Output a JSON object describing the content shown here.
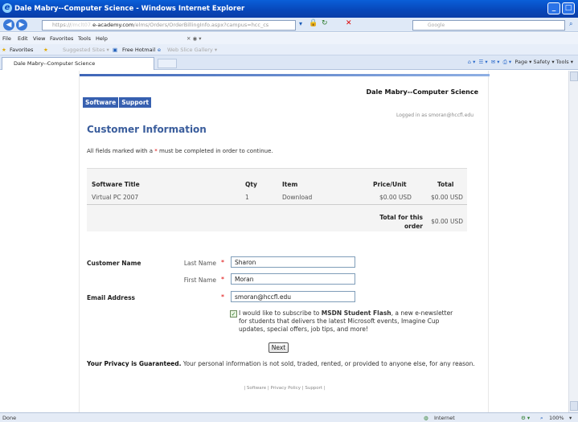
{
  "window": {
    "title": "Dale Mabry--Computer Science - Windows Internet Explorer"
  },
  "address": {
    "url_host": "https://",
    "url_domain": "e-academy.com",
    "url_path": "/elms/Orders/OrderBillingInfo.aspx?campus=hcc_cs",
    "search_placeholder": "Google"
  },
  "menu": {
    "items": [
      "File",
      "Edit",
      "View",
      "Favorites",
      "Tools",
      "Help"
    ]
  },
  "favorites": {
    "label": "Favorites",
    "suggested": "Suggested Sites ▾",
    "hotmail": "Free Hotmail",
    "gallery": "Web Slice Gallery ▾"
  },
  "tab": {
    "title": "Dale Mabry--Computer Science",
    "tools": "Page ▾  Safety ▾  Tools ▾"
  },
  "site": {
    "nav": [
      "Software",
      "Support"
    ],
    "title": "Dale Mabry--Computer Science",
    "logged_in": "Logged in as smoran@hccfl.edu"
  },
  "page": {
    "heading": "Customer Information",
    "note_prefix": "All fields marked with a",
    "note_star": "*",
    "note_suffix": "must be completed in order to continue."
  },
  "cart": {
    "headers": {
      "title": "Software Title",
      "qty": "Qty",
      "item": "Item",
      "price": "Price/Unit",
      "total": "Total"
    },
    "row": {
      "title": "Virtual PC 2007",
      "qty": "1",
      "item": "Download",
      "price": "$0.00 USD",
      "total": "$0.00 USD"
    },
    "total_label": "Total for this order",
    "total_value": "$0.00 USD"
  },
  "form": {
    "customer_name_label": "Customer Name",
    "last_name_label": "Last Name",
    "last_name_value": "Sharon",
    "first_name_label": "First Name",
    "first_name_value": "Moran",
    "email_label": "Email Address",
    "email_value": "smoran@hccfl.edu",
    "required_mark": "*",
    "subscribe_pre": "I would like to subscribe to",
    "subscribe_bold": "MSDN Student Flash",
    "subscribe_post": ", a new e-newsletter for students that delivers the latest Microsoft events, Imagine Cup updates, special offers, job tips, and more!",
    "subscribe_checked": true,
    "next_label": "Next"
  },
  "privacy": {
    "bold": "Your Privacy is Guaranteed.",
    "text": "Your personal information is not sold, traded, rented, or provided to anyone else, for any reason."
  },
  "footer": {
    "links": "| Software | Privacy Policy | Support |"
  },
  "status": {
    "left": "Done",
    "zone": "Internet",
    "zoom": "100%"
  }
}
